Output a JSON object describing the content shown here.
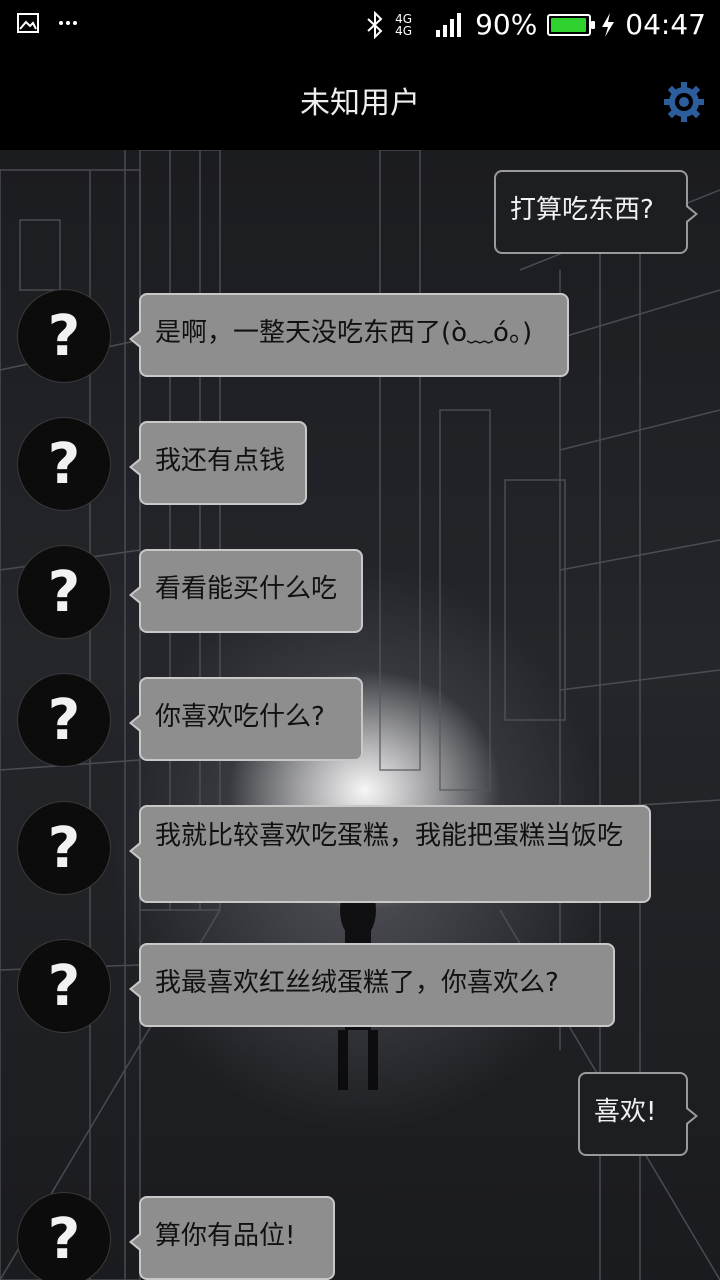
{
  "status_bar": {
    "network": "4G 4G",
    "battery": "90%",
    "time": "04:47",
    "icons": [
      "image-icon",
      "more-icon",
      "bluetooth-icon",
      "signal-icon",
      "battery-icon",
      "charging-icon"
    ]
  },
  "header": {
    "title": "未知用户",
    "settings_icon": "gear-icon"
  },
  "avatar_symbol": "?",
  "messages": [
    {
      "side": "out",
      "text": "打算吃东西?"
    },
    {
      "side": "in",
      "text": "是啊，一整天没吃东西了(ò﹏ó。)"
    },
    {
      "side": "in",
      "text": "我还有点钱"
    },
    {
      "side": "in",
      "text": "看看能买什么吃"
    },
    {
      "side": "in",
      "text": "你喜欢吃什么?"
    },
    {
      "side": "in",
      "text": "我就比较喜欢吃蛋糕，我能把蛋糕当饭吃"
    },
    {
      "side": "in",
      "text": "我最喜欢红丝绒蛋糕了，你喜欢么?"
    },
    {
      "side": "out",
      "text": "喜欢!"
    },
    {
      "side": "in",
      "text": "算你有品位!"
    }
  ],
  "colors": {
    "incoming_bubble": "#8e8e8e",
    "outgoing_bubble": "#1d1e22",
    "battery": "#2fd22f",
    "gear": "#2c5d9c"
  }
}
